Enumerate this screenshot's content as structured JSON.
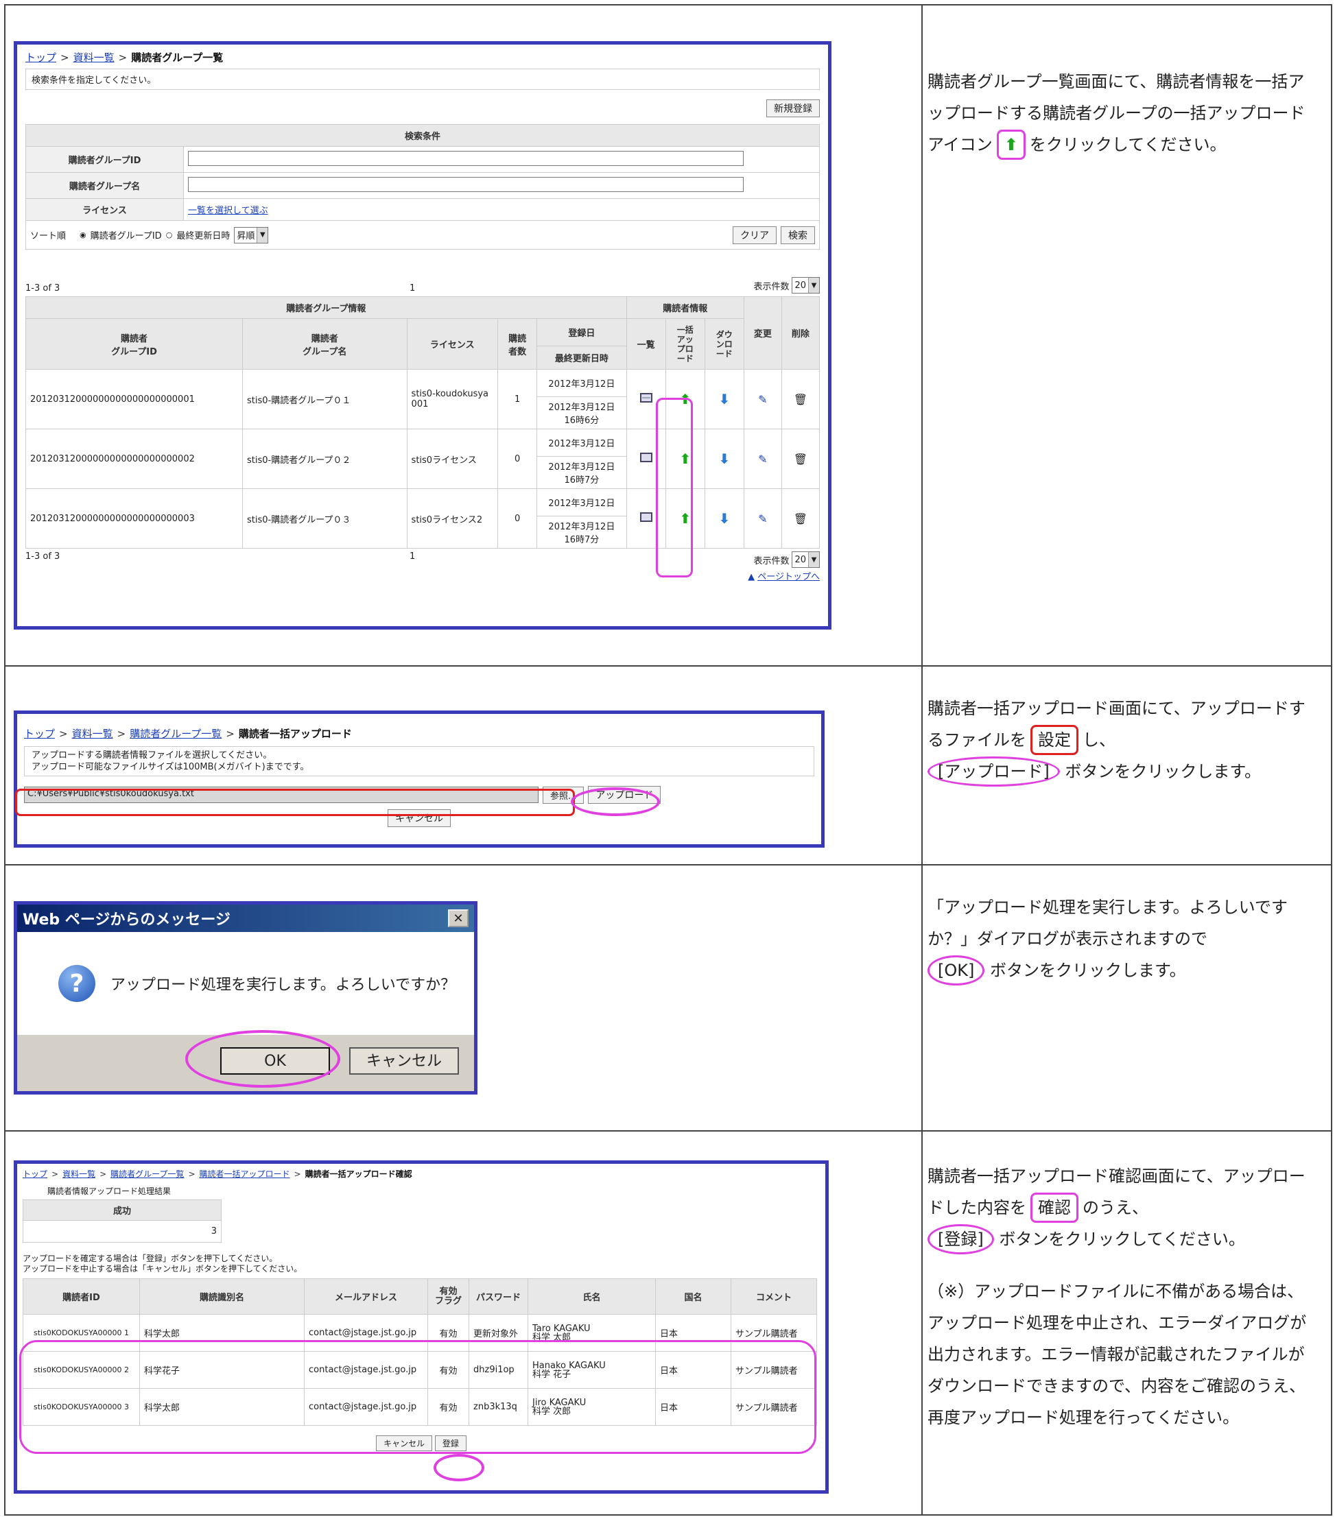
{
  "section1": {
    "breadcrumb": {
      "top": "トップ",
      "list": "資料一覧",
      "current": "購読者グループ一覧"
    },
    "instruction": "検索条件を指定してください。",
    "new_button": "新規登録",
    "search_header": "検索条件",
    "field_group_id": "購読者グループID",
    "field_group_name": "購読者グループ名",
    "field_license": "ライセンス",
    "license_link": "一覧を選択して選ぶ",
    "sort_label": "ソート順",
    "sort_opt1": "購読者グループID",
    "sort_opt2": "最終更新日時",
    "sort_order": "昇順",
    "clear_button": "クリア",
    "search_button": "検索",
    "range": "1-3 of 3",
    "page": "1",
    "per_page_label": "表示件数",
    "per_page": "20",
    "page_top": "ページトップへ",
    "col_group_info": "購読者グループ情報",
    "col_subscriber_info": "購読者情報",
    "col_group_id": "購読者\nグループID",
    "col_group_name": "購読者\nグループ名",
    "col_license": "ライセンス",
    "col_count": "購読\n者数",
    "col_registered": "登録日",
    "col_updated": "最終更新日時",
    "col_list": "一覧",
    "col_bulk_upload": "一括\nアッ\nプロ\nード",
    "col_download": "ダウ\nンロ\nード",
    "col_edit": "変更",
    "col_delete": "削除",
    "rows": [
      {
        "id": "20120312000000000000000000001",
        "name": "stis0-購読者グループ０１",
        "license": "stis0-koudokusya001",
        "count": "1",
        "registered": "2012年3月12日",
        "updated": "2012年3月12日 16時6分"
      },
      {
        "id": "20120312000000000000000000002",
        "name": "stis0-購読者グループ０２",
        "license": "stis0ライセンス",
        "count": "0",
        "registered": "2012年3月12日",
        "updated": "2012年3月12日 16時7分"
      },
      {
        "id": "20120312000000000000000000003",
        "name": "stis0-購読者グループ０３",
        "license": "stis0ライセンス2",
        "count": "0",
        "registered": "2012年3月12日",
        "updated": "2012年3月12日 16時7分"
      }
    ],
    "desc_a": "購読者グループ一覧画面にて、購読者情報を一括アップロードする購読者グループの一括アップロードアイコン",
    "desc_b": "をクリックしてください。"
  },
  "section2": {
    "breadcrumb": {
      "top": "トップ",
      "list": "資料一覧",
      "group": "購読者グループ一覧",
      "current": "購読者一括アップロード"
    },
    "instruction1": "アップロードする購読者情報ファイルを選択してください。",
    "instruction2": "アップロード可能なファイルサイズは100MB(メガバイト)までです。",
    "file_path": "C:¥Users¥Public¥stis0koudokusya.txt",
    "browse_button": "参照...",
    "upload_button": "アップロード",
    "cancel_button": "キャンセル",
    "desc_a": "購読者一括アップロード画面にて、アップロードするファイルを",
    "desc_boxed": "設定",
    "desc_b": "し、",
    "desc_oval": "[アップロード]",
    "desc_c": "ボタンをクリックします。"
  },
  "section3": {
    "dialog_title": "Web ページからのメッセージ",
    "dialog_message": "アップロード処理を実行します。よろしいですか？",
    "ok_button": "OK",
    "cancel_button": "キャンセル",
    "desc_a": "「アップロード処理を実行します。よろしいですか？」ダイアログが表示されますので",
    "desc_oval": "[OK]",
    "desc_b": "ボタンをクリックします。"
  },
  "section4": {
    "breadcrumb": {
      "top": "トップ",
      "list": "資料一覧",
      "group": "購読者グループ一覧",
      "upload": "購読者一括アップロード",
      "current": "購読者一括アップロード確認"
    },
    "result_title": "購読者情報アップロード処理結果",
    "success_label": "成功",
    "success_count": "3",
    "note1": "アップロードを確定する場合は「登録」ボタンを押下してください。",
    "note2": "アップロードを中止する場合は「キャンセル」ボタンを押下してください。",
    "col_id": "購読者ID",
    "col_identifier": "購読識別名",
    "col_email": "メールアドレス",
    "col_flag": "有効\nフラグ",
    "col_password": "パスワード",
    "col_name": "氏名",
    "col_country": "国名",
    "col_comment": "コメント",
    "rows": [
      {
        "id": "stis0KODOKUSYA00000 1",
        "identifier": "科学太郎",
        "email": "contact@jstage.jst.go.jp",
        "flag": "有効",
        "password": "更新対象外",
        "name_en": "Taro KAGAKU",
        "name_ja": "科学 太郎",
        "country": "日本",
        "comment": "サンプル購読者"
      },
      {
        "id": "stis0KODOKUSYA00000 2",
        "identifier": "科学花子",
        "email": "contact@jstage.jst.go.jp",
        "flag": "有効",
        "password": "dhz9i1op",
        "name_en": "Hanako KAGAKU",
        "name_ja": "科学 花子",
        "country": "日本",
        "comment": "サンプル購読者"
      },
      {
        "id": "stis0KODOKUSYA00000 3",
        "identifier": "科学太郎",
        "email": "contact@jstage.jst.go.jp",
        "flag": "有効",
        "password": "znb3k13q",
        "name_en": "Jiro KAGAKU",
        "name_ja": "科学 次郎",
        "country": "日本",
        "comment": "サンプル購読者"
      }
    ],
    "cancel_button": "キャンセル",
    "register_button": "登録",
    "desc_a": "購読者一括アップロード確認画面にて、アップロードした内容を",
    "desc_boxed": "確認",
    "desc_b": "のうえ、",
    "desc_oval": "[登録]",
    "desc_c": "ボタンをクリックしてください。",
    "desc_note": "（※）アップロードファイルに不備がある場合は、アップロード処理を中止され、エラーダイアログが出力されます。エラー情報が記載されたファイルがダウンロードできますので、内容をご確認のうえ、再度アップロード処理を行ってください。"
  },
  "colors": {
    "frame": "#3a3ab8",
    "highlight": "#e040e0",
    "highlight_red": "#e02020",
    "up_icon": "#1aa81a",
    "down_icon": "#2a7ad8"
  }
}
